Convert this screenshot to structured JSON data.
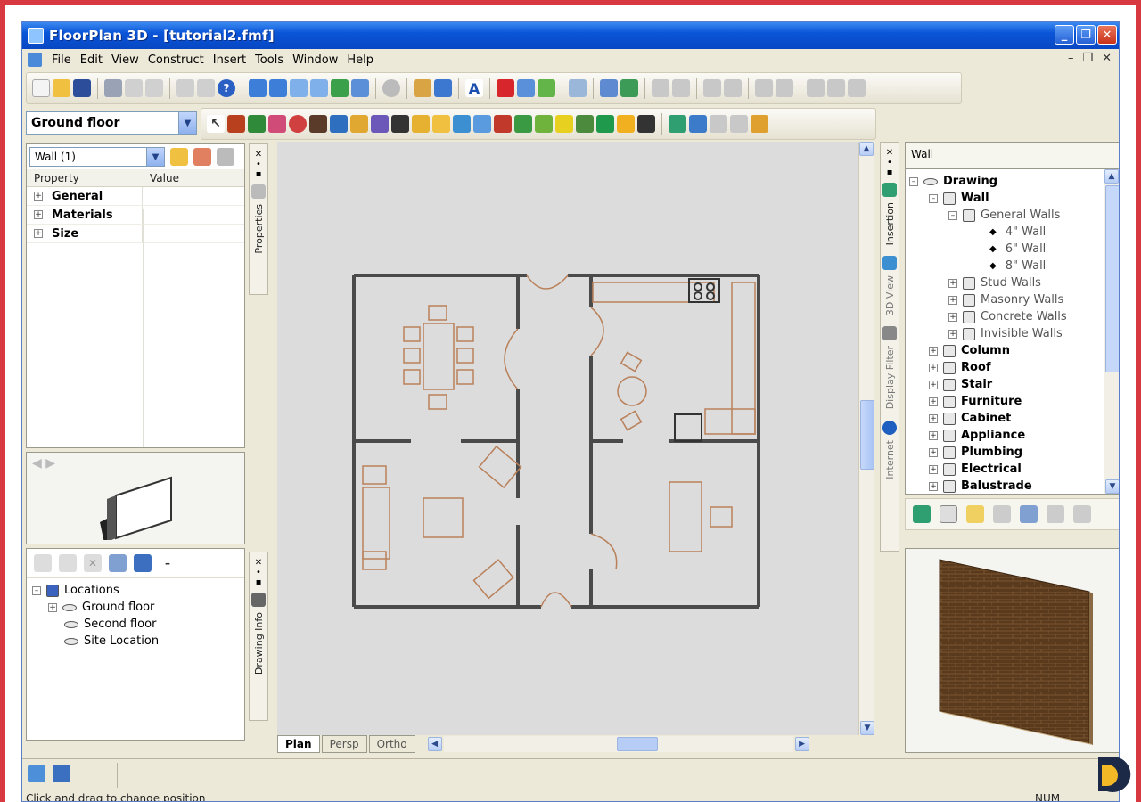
{
  "window": {
    "title": "FloorPlan 3D - [tutorial2.fmf]"
  },
  "menu": [
    "File",
    "Edit",
    "View",
    "Construct",
    "Insert",
    "Tools",
    "Window",
    "Help"
  ],
  "floor_selector": {
    "value": "Ground floor"
  },
  "properties": {
    "object_select": "Wall (1)",
    "col_property": "Property",
    "col_value": "Value",
    "groups": [
      "General",
      "Materials",
      "Size"
    ]
  },
  "locations": {
    "root": "Locations",
    "items": [
      "Ground floor",
      "Second floor",
      "Site Location"
    ]
  },
  "side_tabs": {
    "properties": "Properties",
    "drawing_info": "Drawing Info",
    "insertion": "Insertion",
    "view_3d": "3D View",
    "display_filter": "Display Filter",
    "internet": "Internet"
  },
  "catalog": {
    "header": "Wall",
    "root": "Drawing",
    "wall": "Wall",
    "general_walls": "General Walls",
    "general_items": [
      "4\" Wall",
      "6\" Wall",
      "8\" Wall"
    ],
    "wall_groups": [
      "Stud Walls",
      "Masonry Walls",
      "Concrete Walls",
      "Invisible Walls"
    ],
    "categories": [
      "Column",
      "Roof",
      "Stair",
      "Furniture",
      "Cabinet",
      "Appliance",
      "Plumbing",
      "Electrical",
      "Balustrade"
    ]
  },
  "view_tabs": [
    "Plan",
    "Persp",
    "Ortho"
  ],
  "status": {
    "hint": "Click and drag to change position",
    "right": "NUM"
  },
  "colors": {
    "title_bar": "#0a55d8",
    "canvas": "#dcdcdc",
    "wall": "#4a4a4a",
    "furniture": "#b9805a",
    "border": "#d8383f"
  }
}
